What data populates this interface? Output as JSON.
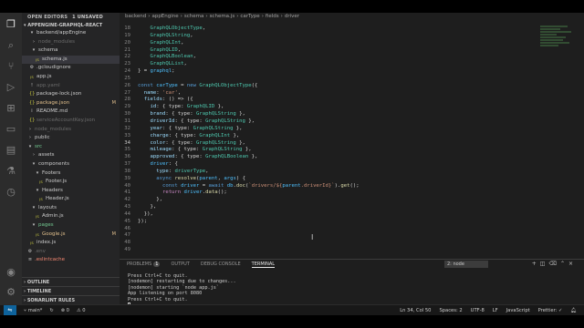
{
  "sidebar": {
    "open_editors": "OPEN EDITORS",
    "open_editors_badge": "1 UNSAVED",
    "project": "APPENGINE-GRAPHQL-REACT",
    "tree": [
      {
        "label": "backend/appEngine",
        "icon": "▾",
        "type": "folder"
      },
      {
        "label": "node_modules",
        "icon": "›",
        "type": "folder",
        "dim": true
      },
      {
        "label": "schema",
        "icon": "▾",
        "type": "folder"
      },
      {
        "label": "schema.js",
        "icon": "JS",
        "type": "file",
        "selected": true
      },
      {
        "label": ".gcloudignore",
        "icon": "⚙",
        "type": "file"
      },
      {
        "label": "app.js",
        "icon": "JS",
        "type": "file"
      },
      {
        "label": "app.yaml",
        "icon": "!",
        "type": "file",
        "dim": true
      },
      {
        "label": "package-lock.json",
        "icon": "{}",
        "type": "file"
      },
      {
        "label": "package.json",
        "icon": "{}",
        "type": "file",
        "badge": "M",
        "mod": true
      },
      {
        "label": "README.md",
        "icon": "i",
        "type": "file"
      },
      {
        "label": "serviceAccountKey.json",
        "icon": "{}",
        "type": "file",
        "dim": true
      },
      {
        "label": "node_modules",
        "icon": "›",
        "type": "folder",
        "dim": true
      },
      {
        "label": "public",
        "icon": "›",
        "type": "folder"
      },
      {
        "label": "src",
        "icon": "▾",
        "type": "folder",
        "green": true
      },
      {
        "label": "assets",
        "icon": "›",
        "type": "folder"
      },
      {
        "label": "components",
        "icon": "▾",
        "type": "folder"
      },
      {
        "label": "Footers",
        "icon": "▾",
        "type": "folder"
      },
      {
        "label": "Footer.js",
        "icon": "JS",
        "type": "file"
      },
      {
        "label": "Headers",
        "icon": "▾",
        "type": "folder"
      },
      {
        "label": "Header.js",
        "icon": "JS",
        "type": "file"
      },
      {
        "label": "layouts",
        "icon": "▾",
        "type": "folder"
      },
      {
        "label": "Admin.js",
        "icon": "JS",
        "type": "file"
      },
      {
        "label": "pages",
        "icon": "▾",
        "type": "folder",
        "green": true
      },
      {
        "label": "Google.js",
        "icon": "JS",
        "type": "file",
        "badge": "M",
        "mod": true
      },
      {
        "label": "index.js",
        "icon": "JS",
        "type": "file"
      },
      {
        "label": ".env",
        "icon": "⚙",
        "type": "file",
        "dim": true
      },
      {
        "label": ".eslintcache",
        "icon": "≡",
        "type": "file",
        "red": true
      }
    ],
    "bottom_sections": [
      "OUTLINE",
      "TIMELINE",
      "SONARLINT RULES"
    ]
  },
  "editor": {
    "breadcrumb": [
      "backend",
      "appEngine",
      "schema",
      "schema.js",
      "carType",
      "fields",
      "driver"
    ],
    "lines": [
      {
        "n": "18",
        "t": "    GraphQLObjectType,"
      },
      {
        "n": "19",
        "t": "    GraphQLString,"
      },
      {
        "n": "20",
        "t": "    GraphQLInt,"
      },
      {
        "n": "21",
        "t": "    GraphQLID,"
      },
      {
        "n": "22",
        "t": "    GraphQLBoolean,"
      },
      {
        "n": "23",
        "t": "    GraphQLList,"
      },
      {
        "n": "24",
        "t": "} = graphql;"
      },
      {
        "n": "25",
        "t": ""
      },
      {
        "n": "26",
        "t": "const carType = new GraphQLObjectType({"
      },
      {
        "n": "27",
        "t": "  name: 'car',"
      },
      {
        "n": "28",
        "t": "  fields: () => ({"
      },
      {
        "n": "29",
        "t": "    id: { type: GraphQLID },"
      },
      {
        "n": "30",
        "t": "    brand: { type: GraphQLString },"
      },
      {
        "n": "31",
        "t": "    driverId: { type: GraphQLString },"
      },
      {
        "n": "32",
        "t": "    year: { type: GraphQLString },"
      },
      {
        "n": "33",
        "t": "    charge: { type: GraphQLInt },"
      },
      {
        "n": "34",
        "t": "    color: { type: GraphQLString },"
      },
      {
        "n": "35",
        "t": "    mileage: { type: GraphQLString },"
      },
      {
        "n": "36",
        "t": "    approved: { type: GraphQLBoolean },"
      },
      {
        "n": "37",
        "t": "    driver: {"
      },
      {
        "n": "38",
        "t": "      type: driverType,"
      },
      {
        "n": "39",
        "t": "      async resolve(parent, args) {"
      },
      {
        "n": "40",
        "t": "        const driver = await db.doc(`drivers/${parent.driverId}`).get();"
      },
      {
        "n": "41",
        "t": "        return driver.data();"
      },
      {
        "n": "42",
        "t": "      },"
      },
      {
        "n": "43",
        "t": "    },"
      },
      {
        "n": "44",
        "t": "  }),"
      },
      {
        "n": "45",
        "t": "});"
      },
      {
        "n": "46",
        "t": ""
      },
      {
        "n": "47",
        "t": ""
      },
      {
        "n": "48",
        "t": ""
      },
      {
        "n": "49",
        "t": ""
      }
    ]
  },
  "panel": {
    "tabs": [
      "PROBLEMS",
      "OUTPUT",
      "DEBUG CONSOLE",
      "TERMINAL"
    ],
    "problems_count": "1",
    "terminal_select": "2: node",
    "terminal_lines": [
      "Press Ctrl+C to quit.",
      "[nodemon] restarting due to changes...",
      "[nodemon] starting `node app.js`",
      "App listening on port 8080",
      "Press Ctrl+C to quit."
    ]
  },
  "status": {
    "branch": "main*",
    "sync": "↻",
    "errors": "⊗ 0",
    "warnings": "⚠ 0",
    "position": "Ln 34, Col 50",
    "spaces": "Spaces: 2",
    "encoding": "UTF-8",
    "eol": "LF",
    "language": "JavaScript",
    "prettier": "Prettier: ✓"
  }
}
